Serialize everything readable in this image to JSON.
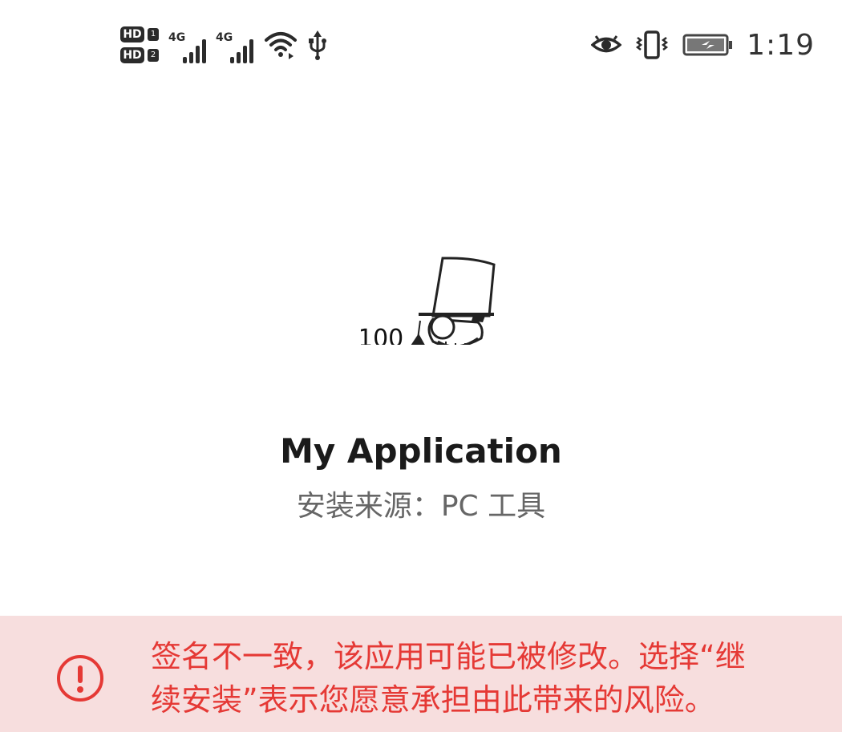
{
  "status_bar": {
    "sim1_badge": "HD",
    "sim1_slot": "1",
    "sim2_badge": "HD",
    "sim2_slot": "2",
    "network1": "4G",
    "network2": "4G",
    "time": "1:19",
    "icons": [
      "wifi-icon",
      "usb-icon",
      "eye-icon",
      "vibrate-icon",
      "battery-icon"
    ],
    "battery_color": "#444444"
  },
  "app": {
    "icon_text": "100",
    "icon_name": "detective-hat-icon",
    "title": "My Application",
    "source": "安装来源：PC 工具"
  },
  "warning": {
    "line1": "签名不一致，该应用可能已被修改。选择“继",
    "line2": "续安装”表示您愿意承担由此带来的风险。",
    "icon_name": "alert-circle-icon",
    "accent": "#e53935",
    "background": "#f7dede"
  }
}
